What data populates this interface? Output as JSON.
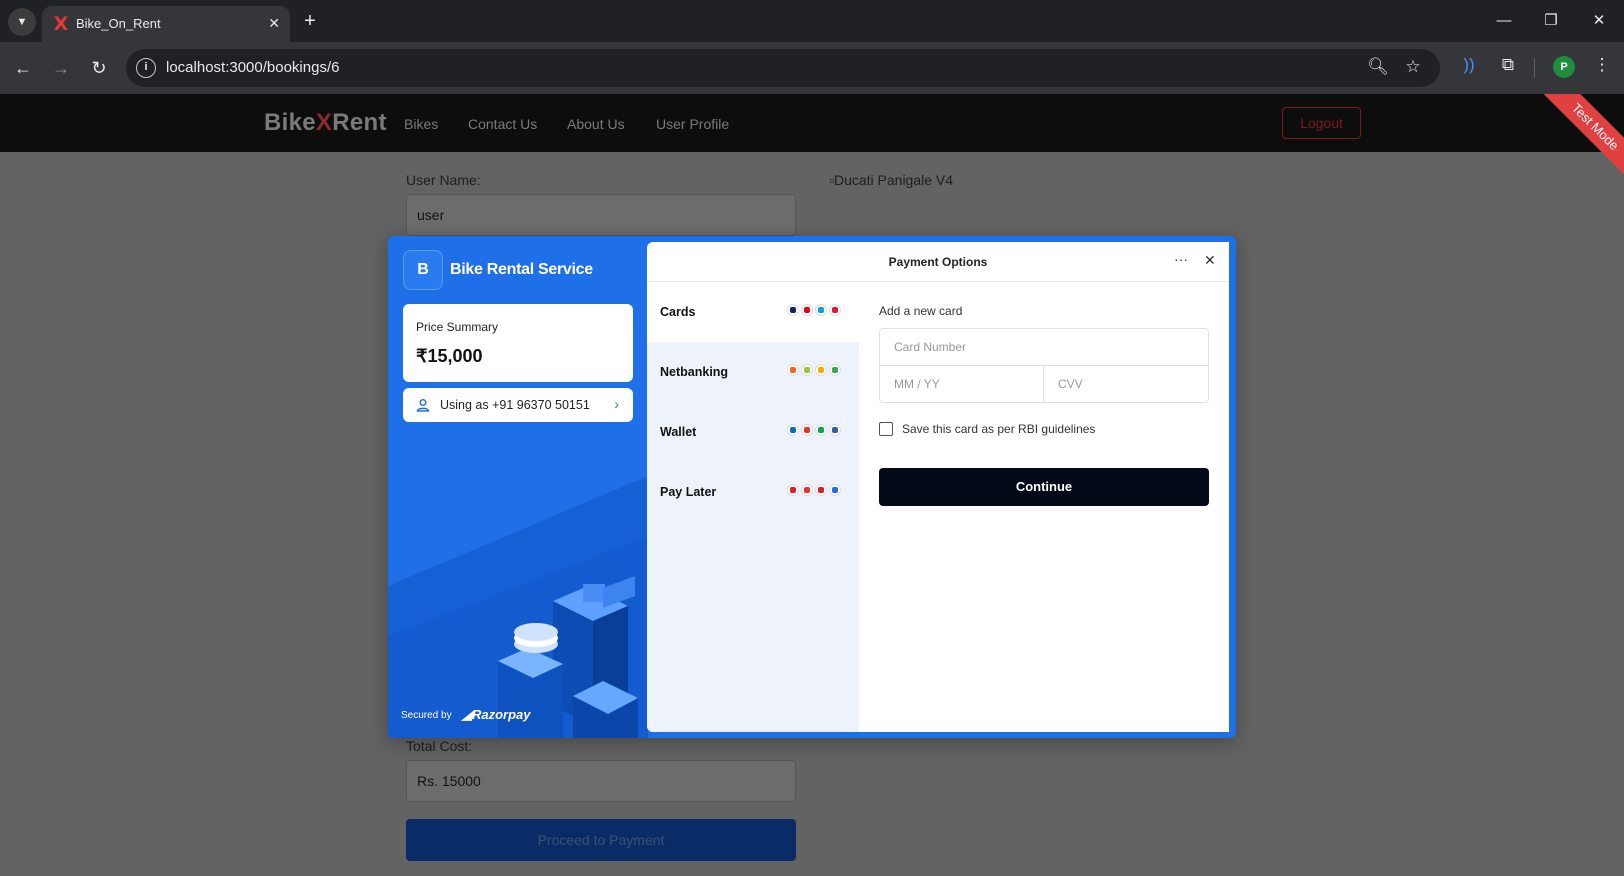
{
  "browser": {
    "tab_title": "Bike_On_Rent",
    "tab_close": "✕",
    "new_tab": "+",
    "url": "localhost:3000/bookings/6",
    "profile_initial": "P"
  },
  "site": {
    "brand_part1": "Bike",
    "brand_x": "X",
    "brand_part2": "Rent",
    "nav_links": [
      "Bikes",
      "Contact Us",
      "About Us",
      "User Profile"
    ],
    "logout": "Logout",
    "test_mode": "Test Mode"
  },
  "booking": {
    "user_name_label": "User Name:",
    "user_name_value": "user",
    "bike_image_alt": "Ducati Panigale V4",
    "total_cost_label": "Total Cost:",
    "total_cost_value": "Rs. 15000",
    "proceed_button": "Proceed to Payment"
  },
  "checkout": {
    "merchant_initial": "B",
    "merchant_name": "Bike Rental Service",
    "price_summary_label": "Price Summary",
    "price_value": "₹15,000",
    "using_as": "Using as +91 96370 50151",
    "secured_by": "Secured by",
    "razorpay": "Razorpay",
    "header_title": "Payment Options",
    "more_icon": "···",
    "close_icon": "✕",
    "methods": [
      {
        "label": "Cards",
        "icons": [
          "#1a1f71",
          "#eb001b",
          "#00a6e0",
          "#e31837"
        ]
      },
      {
        "label": "Netbanking",
        "icons": [
          "#f26522",
          "#97c93d",
          "#f7a800",
          "#3aa757"
        ]
      },
      {
        "label": "Wallet",
        "icons": [
          "#0070ba",
          "#e8322b",
          "#00a651",
          "#2d5fa8"
        ]
      },
      {
        "label": "Pay Later",
        "icons": [
          "#e31b23",
          "#e8322b",
          "#d71f26",
          "#1f6fe8"
        ]
      }
    ],
    "card_form": {
      "heading": "Add a new card",
      "card_number_placeholder": "Card Number",
      "expiry_placeholder": "MM / YY",
      "cvv_placeholder": "CVV",
      "save_card_label": "Save this card as per RBI guidelines",
      "continue_button": "Continue"
    }
  }
}
